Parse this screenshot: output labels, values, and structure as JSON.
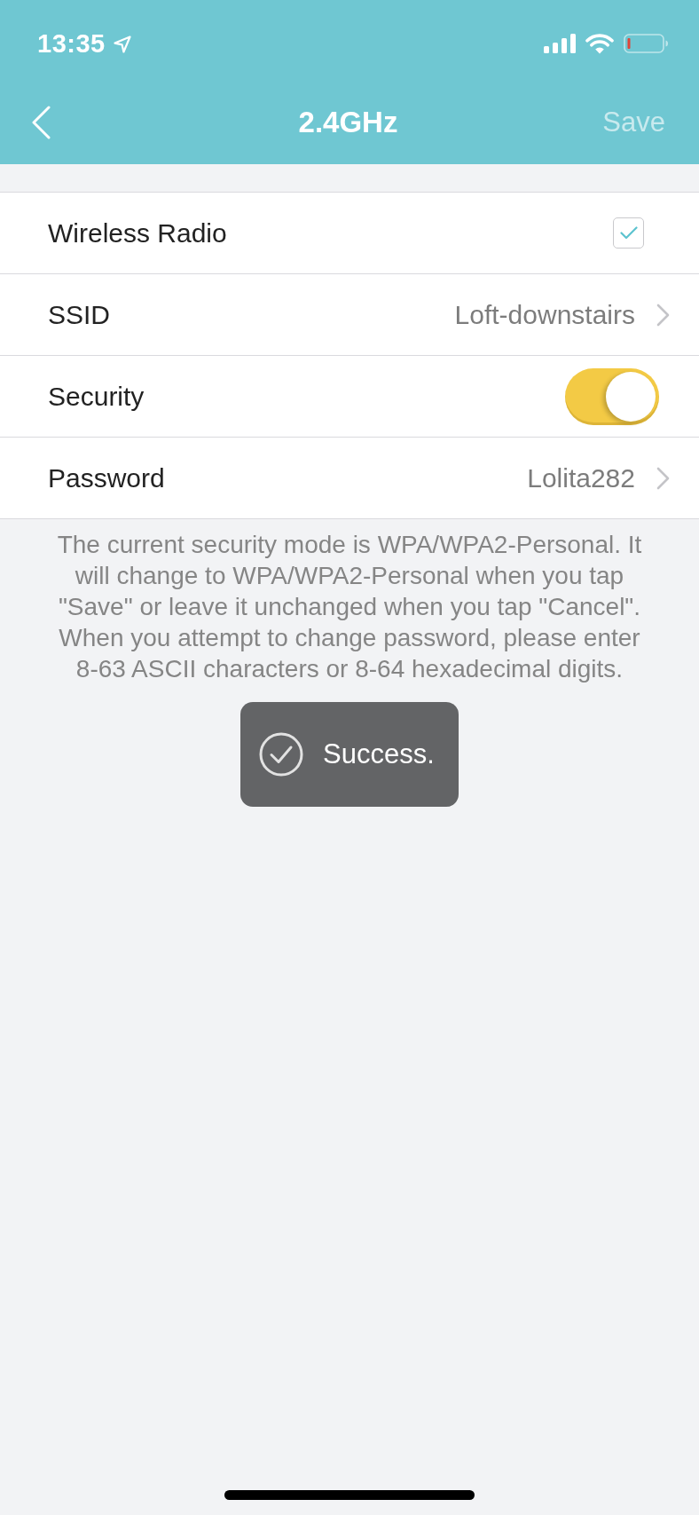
{
  "status_bar": {
    "time": "13:35"
  },
  "nav": {
    "title": "2.4GHz",
    "save": {
      "label": "Save",
      "disabled": true
    }
  },
  "settings": [
    {
      "kind": "checkbox",
      "label": "Wireless Radio",
      "checked": true
    },
    {
      "kind": "link",
      "label": "SSID",
      "value": "Loft-downstairs"
    },
    {
      "kind": "toggle",
      "label": "Security",
      "on": true
    },
    {
      "kind": "link",
      "label": "Password",
      "value": "Lolita282"
    }
  ],
  "note": "The current security mode is WPA/WPA2-Personal. It will change to WPA/WPA2-Personal when you tap \"Save\" or leave it unchanged when you tap \"Cancel\". When you attempt to change password, please enter 8-63 ASCII characters or 8-64 hexadecimal digits.",
  "toast": {
    "message": "Success."
  }
}
